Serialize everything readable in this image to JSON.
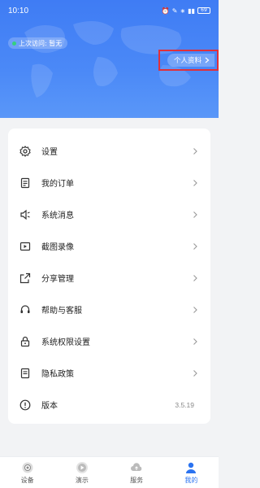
{
  "status_bar": {
    "time": "10:10",
    "battery": "69"
  },
  "header": {
    "last_visit": "上次访问: 暂无",
    "profile_button": "个人资料"
  },
  "menu": [
    {
      "label": "设置",
      "icon": "gear-icon"
    },
    {
      "label": "我的订单",
      "icon": "order-icon"
    },
    {
      "label": "系统消息",
      "icon": "speaker-icon"
    },
    {
      "label": "截图录像",
      "icon": "video-icon"
    },
    {
      "label": "分享管理",
      "icon": "share-icon"
    },
    {
      "label": "帮助与客服",
      "icon": "headset-icon"
    },
    {
      "label": "系统权限设置",
      "icon": "lock-icon"
    },
    {
      "label": "隐私政策",
      "icon": "document-icon"
    },
    {
      "label": "版本",
      "icon": "info-icon",
      "value": "3.5.19"
    }
  ],
  "tabbar": [
    {
      "label": "设备",
      "icon": "camera-icon"
    },
    {
      "label": "演示",
      "icon": "play-icon"
    },
    {
      "label": "服务",
      "icon": "cloud-icon"
    },
    {
      "label": "我的",
      "icon": "profile-icon",
      "active": true
    }
  ],
  "colors": {
    "accent": "#2b73f0",
    "header": "#4b89f7",
    "highlight_border": "#e0303a"
  }
}
